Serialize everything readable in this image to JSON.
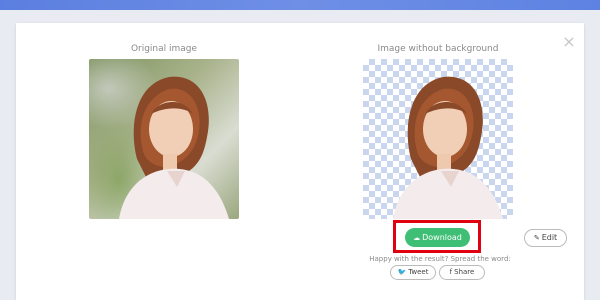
{
  "dialog": {
    "close_label": "×",
    "original": {
      "title": "Original image"
    },
    "result": {
      "title": "Image without background"
    },
    "download": {
      "label": "Download",
      "icon": "cloud-download-icon"
    },
    "edit": {
      "label": "Edit",
      "icon": "pencil-icon"
    },
    "share_prompt": "Happy with the result? Spread the word:",
    "tweet": {
      "label": "Tweet",
      "icon": "twitter-icon"
    },
    "share": {
      "label": "Share",
      "icon": "facebook-icon"
    }
  },
  "colors": {
    "accent_green": "#3fbf75",
    "highlight_red": "#e0000f",
    "checker": "#c9d6ee"
  }
}
